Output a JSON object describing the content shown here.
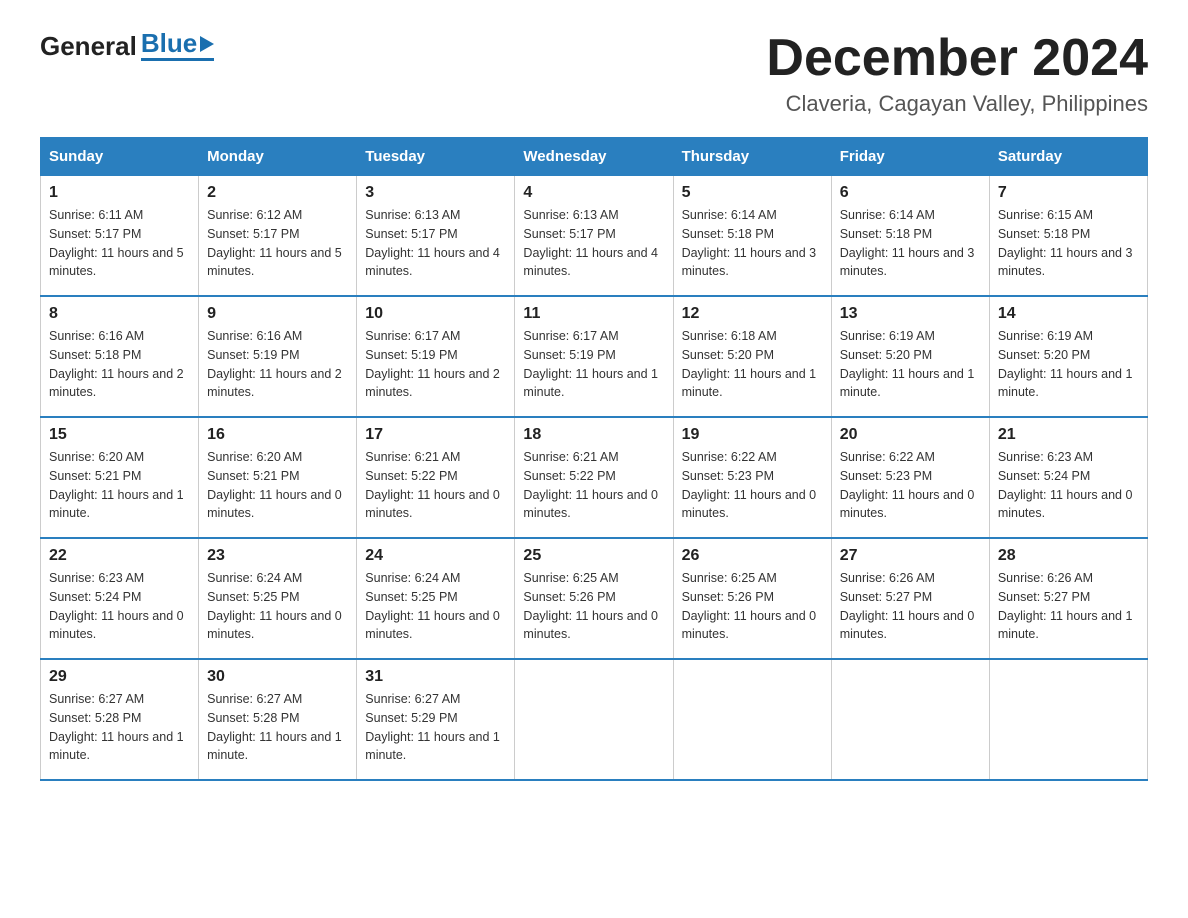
{
  "header": {
    "logo": {
      "general": "General",
      "blue": "Blue",
      "tagline": "Blue"
    },
    "title": "December 2024",
    "location": "Claveria, Cagayan Valley, Philippines"
  },
  "weekdays": [
    "Sunday",
    "Monday",
    "Tuesday",
    "Wednesday",
    "Thursday",
    "Friday",
    "Saturday"
  ],
  "weeks": [
    [
      {
        "day": "1",
        "sunrise": "6:11 AM",
        "sunset": "5:17 PM",
        "daylight": "11 hours and 5 minutes."
      },
      {
        "day": "2",
        "sunrise": "6:12 AM",
        "sunset": "5:17 PM",
        "daylight": "11 hours and 5 minutes."
      },
      {
        "day": "3",
        "sunrise": "6:13 AM",
        "sunset": "5:17 PM",
        "daylight": "11 hours and 4 minutes."
      },
      {
        "day": "4",
        "sunrise": "6:13 AM",
        "sunset": "5:17 PM",
        "daylight": "11 hours and 4 minutes."
      },
      {
        "day": "5",
        "sunrise": "6:14 AM",
        "sunset": "5:18 PM",
        "daylight": "11 hours and 3 minutes."
      },
      {
        "day": "6",
        "sunrise": "6:14 AM",
        "sunset": "5:18 PM",
        "daylight": "11 hours and 3 minutes."
      },
      {
        "day": "7",
        "sunrise": "6:15 AM",
        "sunset": "5:18 PM",
        "daylight": "11 hours and 3 minutes."
      }
    ],
    [
      {
        "day": "8",
        "sunrise": "6:16 AM",
        "sunset": "5:18 PM",
        "daylight": "11 hours and 2 minutes."
      },
      {
        "day": "9",
        "sunrise": "6:16 AM",
        "sunset": "5:19 PM",
        "daylight": "11 hours and 2 minutes."
      },
      {
        "day": "10",
        "sunrise": "6:17 AM",
        "sunset": "5:19 PM",
        "daylight": "11 hours and 2 minutes."
      },
      {
        "day": "11",
        "sunrise": "6:17 AM",
        "sunset": "5:19 PM",
        "daylight": "11 hours and 1 minute."
      },
      {
        "day": "12",
        "sunrise": "6:18 AM",
        "sunset": "5:20 PM",
        "daylight": "11 hours and 1 minute."
      },
      {
        "day": "13",
        "sunrise": "6:19 AM",
        "sunset": "5:20 PM",
        "daylight": "11 hours and 1 minute."
      },
      {
        "day": "14",
        "sunrise": "6:19 AM",
        "sunset": "5:20 PM",
        "daylight": "11 hours and 1 minute."
      }
    ],
    [
      {
        "day": "15",
        "sunrise": "6:20 AM",
        "sunset": "5:21 PM",
        "daylight": "11 hours and 1 minute."
      },
      {
        "day": "16",
        "sunrise": "6:20 AM",
        "sunset": "5:21 PM",
        "daylight": "11 hours and 0 minutes."
      },
      {
        "day": "17",
        "sunrise": "6:21 AM",
        "sunset": "5:22 PM",
        "daylight": "11 hours and 0 minutes."
      },
      {
        "day": "18",
        "sunrise": "6:21 AM",
        "sunset": "5:22 PM",
        "daylight": "11 hours and 0 minutes."
      },
      {
        "day": "19",
        "sunrise": "6:22 AM",
        "sunset": "5:23 PM",
        "daylight": "11 hours and 0 minutes."
      },
      {
        "day": "20",
        "sunrise": "6:22 AM",
        "sunset": "5:23 PM",
        "daylight": "11 hours and 0 minutes."
      },
      {
        "day": "21",
        "sunrise": "6:23 AM",
        "sunset": "5:24 PM",
        "daylight": "11 hours and 0 minutes."
      }
    ],
    [
      {
        "day": "22",
        "sunrise": "6:23 AM",
        "sunset": "5:24 PM",
        "daylight": "11 hours and 0 minutes."
      },
      {
        "day": "23",
        "sunrise": "6:24 AM",
        "sunset": "5:25 PM",
        "daylight": "11 hours and 0 minutes."
      },
      {
        "day": "24",
        "sunrise": "6:24 AM",
        "sunset": "5:25 PM",
        "daylight": "11 hours and 0 minutes."
      },
      {
        "day": "25",
        "sunrise": "6:25 AM",
        "sunset": "5:26 PM",
        "daylight": "11 hours and 0 minutes."
      },
      {
        "day": "26",
        "sunrise": "6:25 AM",
        "sunset": "5:26 PM",
        "daylight": "11 hours and 0 minutes."
      },
      {
        "day": "27",
        "sunrise": "6:26 AM",
        "sunset": "5:27 PM",
        "daylight": "11 hours and 0 minutes."
      },
      {
        "day": "28",
        "sunrise": "6:26 AM",
        "sunset": "5:27 PM",
        "daylight": "11 hours and 1 minute."
      }
    ],
    [
      {
        "day": "29",
        "sunrise": "6:27 AM",
        "sunset": "5:28 PM",
        "daylight": "11 hours and 1 minute."
      },
      {
        "day": "30",
        "sunrise": "6:27 AM",
        "sunset": "5:28 PM",
        "daylight": "11 hours and 1 minute."
      },
      {
        "day": "31",
        "sunrise": "6:27 AM",
        "sunset": "5:29 PM",
        "daylight": "11 hours and 1 minute."
      },
      null,
      null,
      null,
      null
    ]
  ],
  "labels": {
    "sunrise": "Sunrise:",
    "sunset": "Sunset:",
    "daylight": "Daylight:"
  }
}
